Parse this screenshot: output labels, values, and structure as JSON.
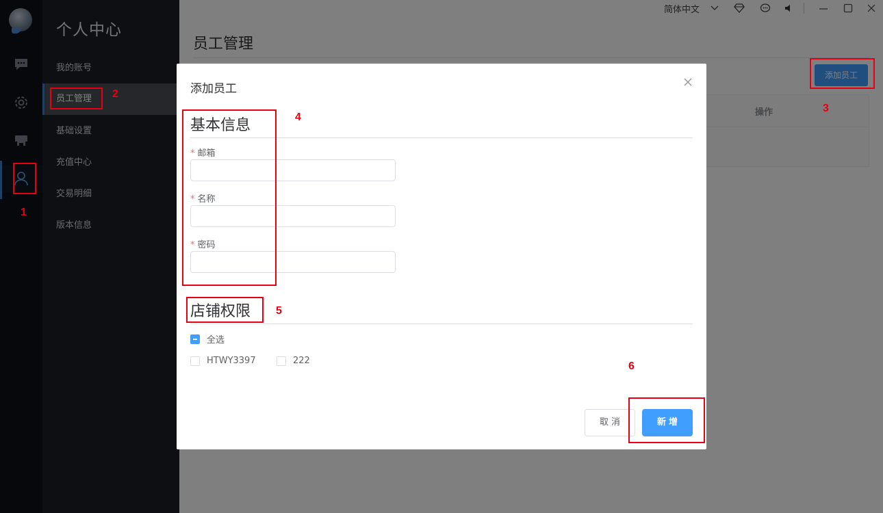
{
  "sidebar": {
    "title": "个人中心",
    "items": [
      {
        "label": "我的账号"
      },
      {
        "label": "员工管理"
      },
      {
        "label": "基础设置"
      },
      {
        "label": "充值中心"
      },
      {
        "label": "交易明细"
      },
      {
        "label": "版本信息"
      }
    ],
    "rail_icons": [
      "chat-icon",
      "gear-icon",
      "shop-icon",
      "user-icon"
    ]
  },
  "topbar": {
    "language": "简体中文"
  },
  "main": {
    "title": "员工管理",
    "add_button": "添加员工",
    "table_header_action": "操作"
  },
  "modal": {
    "title": "添加员工",
    "basic_section": "基本信息",
    "fields": [
      {
        "label": "邮箱",
        "required_mark": "*",
        "value": ""
      },
      {
        "label": "名称",
        "required_mark": "*",
        "value": ""
      },
      {
        "label": "密码",
        "required_mark": "*",
        "value": ""
      }
    ],
    "permission_section": "店铺权限",
    "select_all": "全选",
    "shops": [
      "HTWY3397",
      "222"
    ],
    "cancel": "取消",
    "submit": "新增"
  },
  "annotations": [
    "1",
    "2",
    "3",
    "4",
    "5",
    "6"
  ],
  "colors": {
    "primary": "#409eff",
    "annotation": "#e60012",
    "rail_bg": "#0c1116",
    "menu_bg": "#1b1f24"
  }
}
